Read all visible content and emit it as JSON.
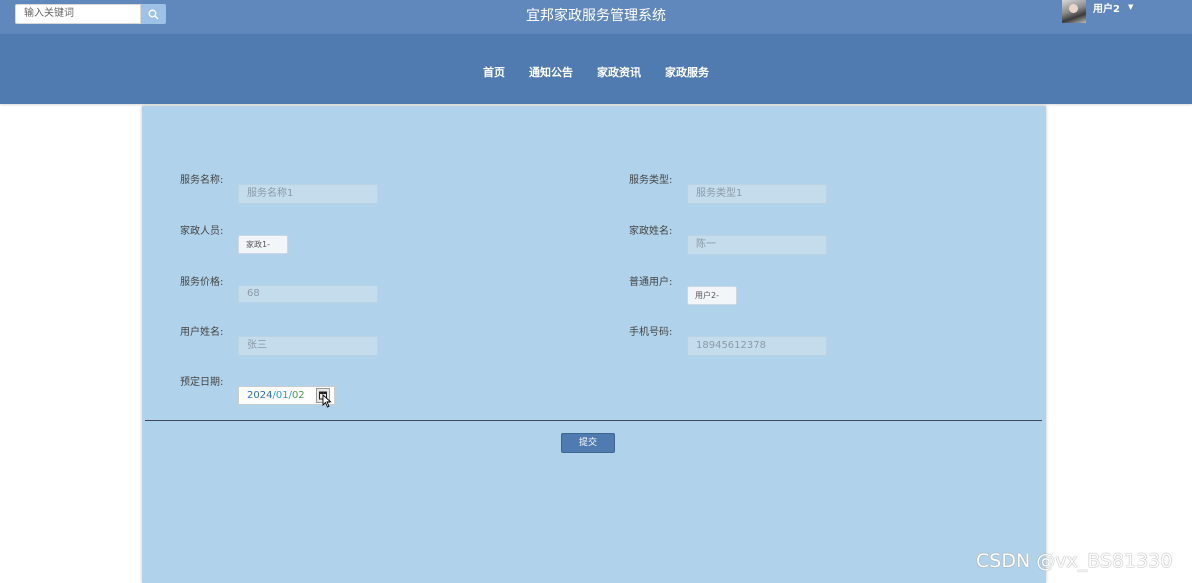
{
  "header": {
    "search_placeholder": "输入关键词",
    "title": "宜邦家政服务管理系统",
    "user_name": "用户2"
  },
  "nav": {
    "items": [
      "首页",
      "通知公告",
      "家政资讯",
      "家政服务"
    ]
  },
  "form": {
    "service_name": {
      "label": "服务名称:",
      "value": "服务名称1"
    },
    "service_type": {
      "label": "服务类型:",
      "value": "服务类型1"
    },
    "housekeeper": {
      "label": "家政人员:",
      "value": "家政1-"
    },
    "housekeeper_name": {
      "label": "家政姓名:",
      "value": "陈一"
    },
    "service_price": {
      "label": "服务价格:",
      "value": "68"
    },
    "normal_user": {
      "label": "普通用户:",
      "value": "用户2-"
    },
    "user_name": {
      "label": "用户姓名:",
      "value": "张三"
    },
    "phone": {
      "label": "手机号码:",
      "value": "18945612378"
    },
    "booking_date": {
      "label": "预定日期:",
      "year": "2024",
      "month": "01",
      "day": "02",
      "sep": "/"
    },
    "submit_label": "提交"
  },
  "watermark": "CSDN @vx_BS81330",
  "colors": {
    "topbar": "#6088bc",
    "navbar": "#4f7bb0",
    "panel": "#b0d3eb"
  }
}
